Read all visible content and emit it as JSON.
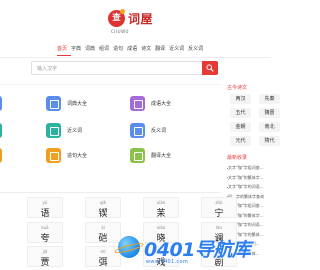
{
  "logo": {
    "seal_text": "查",
    "name": "词屋",
    "sub": "CIIUWU"
  },
  "nav": {
    "items": [
      "首页",
      "字典",
      "词典",
      "组词",
      "造句",
      "成语",
      "诗文",
      "翻译",
      "近义词",
      "反义词"
    ],
    "active_index": 0
  },
  "search": {
    "placeholder": "输入汉字"
  },
  "cards": [
    {
      "label": "词典大全",
      "color": "#5b8def"
    },
    {
      "label": "成语大全",
      "color": "#a56bd8"
    },
    {
      "label": "近义词",
      "color": "#2bb3a0"
    },
    {
      "label": "反义词",
      "color": "#5b8def"
    },
    {
      "label": "造句大全",
      "color": "#f0a020"
    },
    {
      "label": "翻译大全",
      "color": "#8bc34a"
    }
  ],
  "edge_icon_colors": [
    "#5b8def",
    "#2bb3a0",
    "#f0a020"
  ],
  "sidebar": {
    "tag_title": "古今诗文",
    "tags": [
      "两汉",
      "先秦",
      "五代",
      "魏晋",
      "金朝",
      "南北",
      "元代",
      "隋代"
    ],
    "news_title": "最新收录",
    "news": [
      "文字\"咖\"字组词查…",
      "文字\"咖\"的繁体字…",
      "文字\"咖\"字的词语…",
      "同：字的繁体字查询",
      "文字\"咖\"字组词查…",
      "文字\"咖\"的繁体字…",
      "文字\"咖\"字的词语…",
      "文字\"咖\"字的繁体…",
      "文字\"咖\"字组词…",
      "文字\"咖\"的繁体…"
    ]
  },
  "chars": [
    {
      "pinyin": "yǔ",
      "char": "语"
    },
    {
      "pinyin": "qiè",
      "char": "锲"
    },
    {
      "pinyin": "xiàn",
      "char": "苿"
    },
    {
      "pinyin": "zhǔ",
      "char": "宁"
    },
    {
      "pinyin": "kuā",
      "char": "夸"
    },
    {
      "pinyin": "ái",
      "char": "硙"
    },
    {
      "pinyin": "xiǎo",
      "char": "晓"
    },
    {
      "pinyin": "lán",
      "char": "谰"
    },
    {
      "pinyin": "jiǎ",
      "char": "贾"
    },
    {
      "pinyin": "mǐ",
      "char": "弭"
    },
    {
      "pinyin": "xì",
      "char": "戏"
    },
    {
      "pinyin": "jù",
      "char": "剧"
    }
  ],
  "watermark": {
    "text": "0401导航库",
    "url": "www.0401.com"
  }
}
